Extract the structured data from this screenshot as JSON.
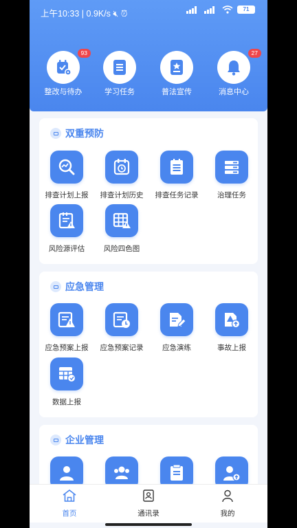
{
  "status": {
    "time": "上午10:33",
    "speed": "0.9K/s",
    "battery": "71"
  },
  "quick": [
    {
      "label": "整改与待办",
      "badge": "93",
      "icon": "calendar-settings-icon"
    },
    {
      "label": "学习任务",
      "badge": "",
      "icon": "document-icon"
    },
    {
      "label": "普法宣传",
      "badge": "",
      "icon": "badge-star-icon"
    },
    {
      "label": "消息中心",
      "badge": "27",
      "icon": "bell-icon"
    }
  ],
  "sections": [
    {
      "title": "双重预防",
      "items": [
        {
          "label": "排查计划上报",
          "icon": "chart-search-icon"
        },
        {
          "label": "排查计划历史",
          "icon": "calendar-history-icon"
        },
        {
          "label": "排查任务记录",
          "icon": "list-icon"
        },
        {
          "label": "治理任务",
          "icon": "server-list-icon"
        },
        {
          "label": "风险源评估",
          "icon": "notebook-warning-icon"
        },
        {
          "label": "风险四色图",
          "icon": "table-warning-icon"
        }
      ]
    },
    {
      "title": "应急管理",
      "items": [
        {
          "label": "应急预案上报",
          "icon": "warning-document-icon"
        },
        {
          "label": "应急预案记录",
          "icon": "clock-document-icon"
        },
        {
          "label": "应急演练",
          "icon": "edit-document-icon"
        },
        {
          "label": "事故上报",
          "icon": "upload-warning-icon"
        },
        {
          "label": "数据上报",
          "icon": "table-upload-icon"
        }
      ]
    },
    {
      "title": "企业管理",
      "items": [
        {
          "label": "",
          "icon": "person-icon"
        },
        {
          "label": "",
          "icon": "group-icon"
        },
        {
          "label": "",
          "icon": "document-lines-icon"
        },
        {
          "label": "",
          "icon": "person-upload-icon"
        }
      ]
    }
  ],
  "tabs": [
    {
      "label": "首页",
      "icon": "home-icon",
      "active": true
    },
    {
      "label": "通讯录",
      "icon": "contacts-icon",
      "active": false
    },
    {
      "label": "我的",
      "icon": "profile-icon",
      "active": false
    }
  ],
  "colors": {
    "primary": "#4a86ee",
    "badge": "#f0464b",
    "active_tab": "#4a86ee"
  }
}
